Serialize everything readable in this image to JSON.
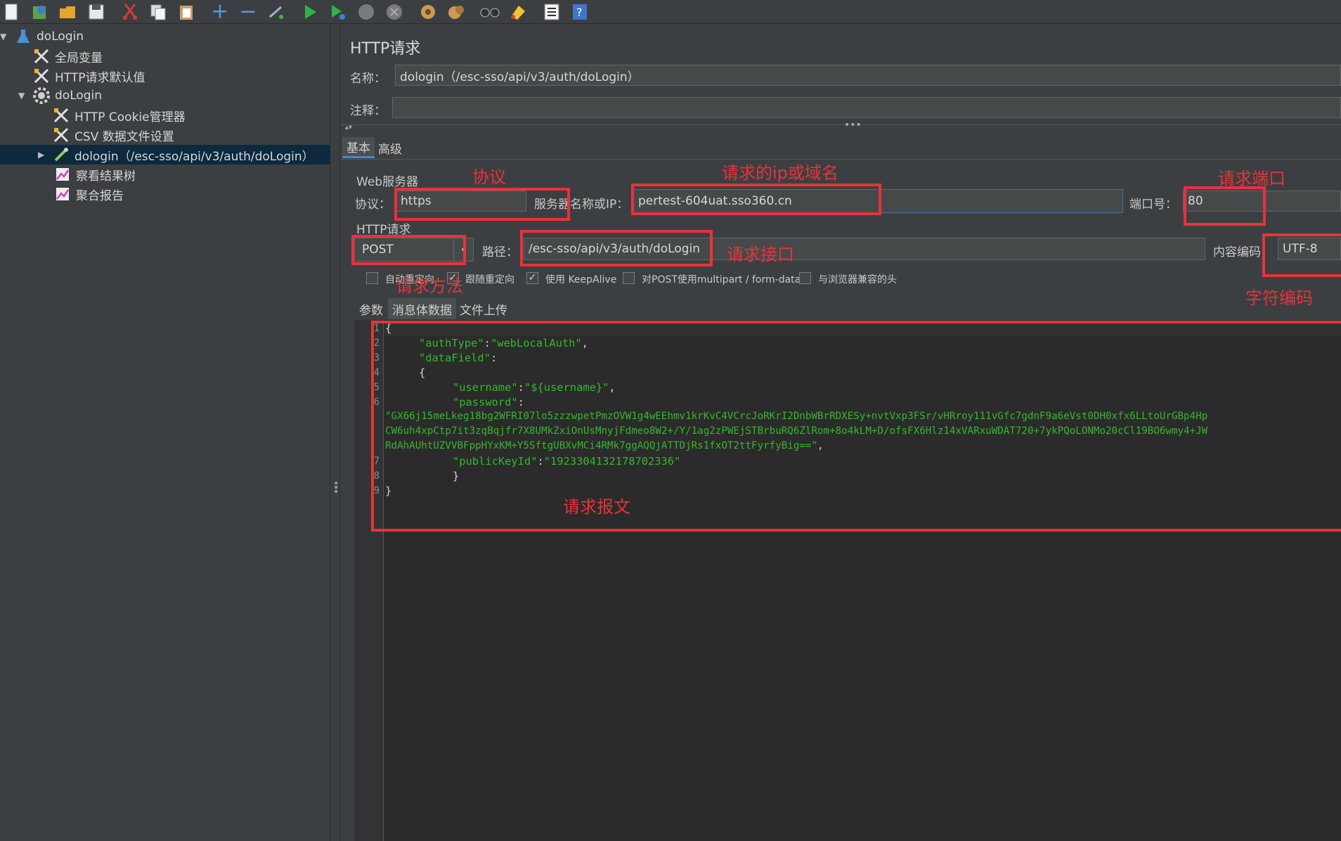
{
  "toolbar": {
    "icons": [
      "new-icon",
      "templates-icon",
      "open-icon",
      "save-icon",
      "cut-icon",
      "copy-icon",
      "paste-icon",
      "expand-icon",
      "collapse-icon",
      "toggle-icon",
      "start-icon",
      "start-no-pause-icon",
      "stop-icon",
      "shutdown-icon",
      "clear-icon",
      "clear-all-icon",
      "search-icon",
      "reset-search-icon",
      "function-helper-icon",
      "help-icon"
    ]
  },
  "tree": {
    "items": [
      {
        "label": "doLogin",
        "icon": "flask-icon"
      },
      {
        "label": "全局变量",
        "icon": "tools-icon"
      },
      {
        "label": "HTTP请求默认值",
        "icon": "tools-icon"
      },
      {
        "label": "doLogin",
        "icon": "gear-icon"
      },
      {
        "label": "HTTP Cookie管理器",
        "icon": "tools-icon"
      },
      {
        "label": "CSV 数据文件设置",
        "icon": "tools-icon"
      },
      {
        "label": "dologin（/esc-sso/api/v3/auth/doLogin）",
        "icon": "pipette-icon"
      },
      {
        "label": "察看结果树",
        "icon": "graph-icon"
      },
      {
        "label": "聚合报告",
        "icon": "graph-icon"
      }
    ]
  },
  "panel": {
    "title": "HTTP请求",
    "name_label": "名称：",
    "name_value": "dologin（/esc-sso/api/v3/auth/doLogin）",
    "comment_label": "注释：",
    "comment_value": "",
    "tabs": [
      "基本",
      "高级"
    ],
    "web_server_label": "Web服务器",
    "protocol_label": "协议：",
    "protocol_value": "https",
    "server_label": "服务器名称或IP：",
    "server_value": "pertest-604uat.sso360.cn",
    "port_label": "端口号：",
    "port_value": "80",
    "http_request_label": "HTTP请求",
    "method_value": "POST",
    "path_label": "路径：",
    "path_value": "/esc-sso/api/v3/auth/doLogin",
    "encoding_label": "内容编码：",
    "encoding_value": "UTF-8",
    "checkboxes": [
      {
        "label": "自动重定向",
        "checked": false
      },
      {
        "label": "跟随重定向",
        "checked": true
      },
      {
        "label": "使用 KeepAlive",
        "checked": true
      },
      {
        "label": "对POST使用multipart / form-data",
        "checked": false
      },
      {
        "label": "与浏览器兼容的头",
        "checked": false
      }
    ],
    "body_tabs": [
      "参数",
      "消息体数据",
      "文件上传"
    ]
  },
  "editor": {
    "line_numbers": [
      "1",
      "2",
      "3",
      "4",
      "5",
      "6",
      "7",
      "8",
      "9"
    ],
    "lines": {
      "l1": "{",
      "l2k": "\"authType\"",
      "l2c": ":",
      "l2v": "\"webLocalAuth\"",
      "l2e": ",",
      "l3k": "\"dataField\"",
      "l3c": ":",
      "l4": "{",
      "l5k": "\"username\"",
      "l5c": ":",
      "l5v": "\"${username}\"",
      "l5e": ",",
      "l6k": "\"password\"",
      "l6c": ":",
      "l6v1": "\"GX66j15meLkeg18bg2WFRI07lo5zzzwpetPmzOVW1g4wEEhmv1krKvC4VCrcJoRKrI2DnbWBrRDXESy+nvtVxp3FSr/vHRroy111vGfc7gdnF9a6eVst0DH0xfx6LLtoUrGBp4Hp",
      "l6v2": "CW6uh4xpCtp7it3zqBqjfr7X8UMkZxiOnUsMnyjFdmeo8W2+/Y/1ag2zPWEjSTBrbuRQ6ZlRom+8o4kLM+D/ofsFX6Hlz14xVARxuWDAT720+7ykPQoLONMo20cCl19BO6wmy4+JW",
      "l6v3": "RdAhAUhtUZVVBFppHYxKM+Y5SftgUBXvMCi4RMk7ggAQQjATTDjRs1fxOT2ttFyrfyBig==\"",
      "l6e": ",",
      "l7k": "\"publicKeyId\"",
      "l7c": ":",
      "l7v": "\"1923304132178702336\"",
      "l8": "}",
      "l9": "}"
    }
  },
  "annotations": {
    "protocol": "协议",
    "server": "请求的ip或域名",
    "port": "请求端口",
    "method": "请求方法",
    "path": "请求接口",
    "encoding": "字符编码",
    "body": "请求报文"
  },
  "colors": {
    "annotation": "#e8323c",
    "string": "#33b92c",
    "selection": "#0d293e"
  }
}
